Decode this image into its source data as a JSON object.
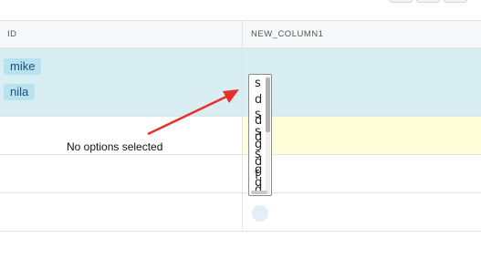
{
  "grid": {
    "columns": [
      "ID",
      "NEW_COLUMN1"
    ],
    "rows": [
      {
        "id_chips": [
          "mike",
          "nila"
        ]
      }
    ]
  },
  "listbox": {
    "options": [
      "s",
      "d",
      "s",
      "d",
      "s",
      "d",
      "g",
      "s",
      "d",
      "g",
      "f",
      "d",
      "d"
    ]
  },
  "annotation": {
    "text": "No options selected",
    "arrow_color": "#e8302a"
  }
}
